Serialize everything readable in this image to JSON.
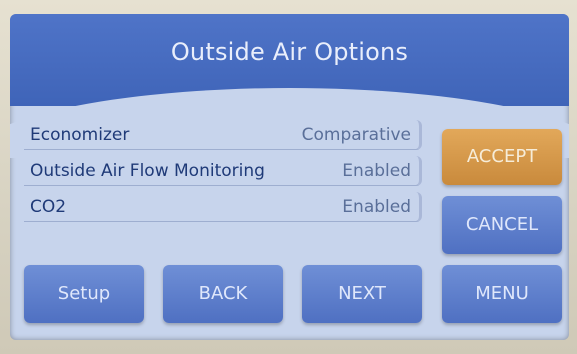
{
  "header": {
    "title": "Outside Air Options"
  },
  "options": [
    {
      "label": "Economizer",
      "value": "Comparative"
    },
    {
      "label": "Outside Air Flow Monitoring",
      "value": "Enabled"
    },
    {
      "label": "CO2",
      "value": "Enabled"
    }
  ],
  "side_buttons": {
    "accept": "ACCEPT",
    "cancel": "CANCEL"
  },
  "bottom_buttons": {
    "setup": "Setup",
    "back": "BACK",
    "next": "NEXT",
    "menu": "MENU"
  },
  "colors": {
    "header_blue": "#4f74c8",
    "panel_bg": "#c7d4ec",
    "button_blue": "#5f80cc",
    "accept_orange": "#d99a4b",
    "label_text": "#1f3a78"
  }
}
